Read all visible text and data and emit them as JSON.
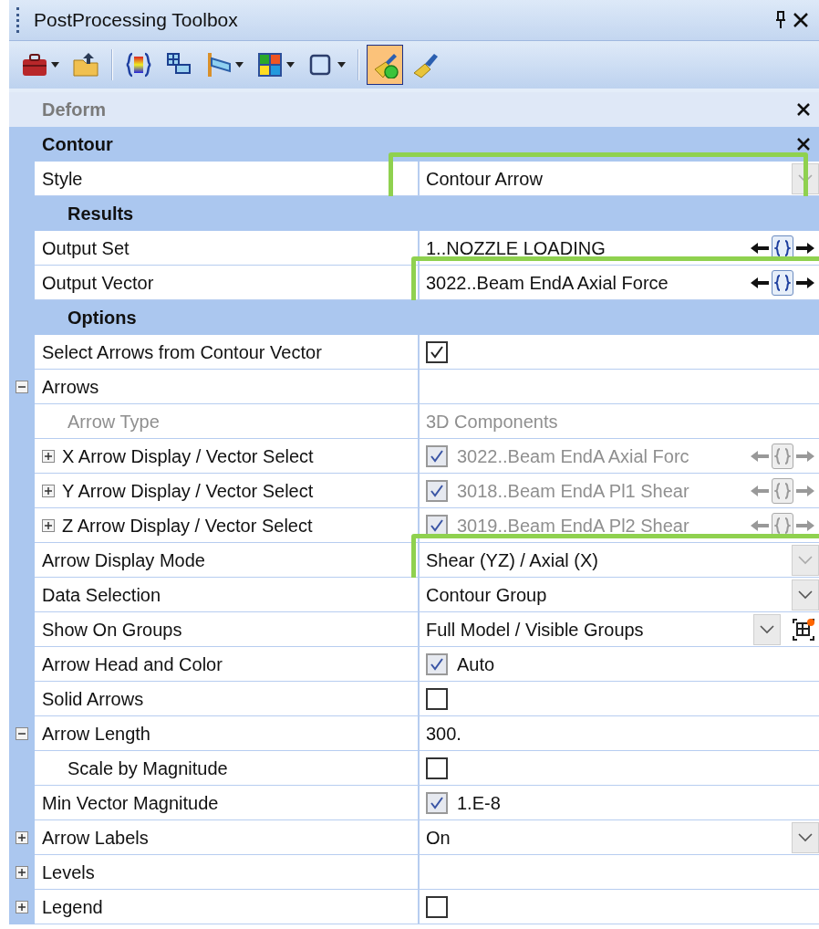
{
  "window": {
    "title": "PostProcessing Toolbox"
  },
  "toolbar": [
    {
      "kind": "toolbox",
      "dropdown": true,
      "selected": false
    },
    {
      "kind": "folder-up",
      "selected": false
    },
    {
      "kind": "separator"
    },
    {
      "kind": "braces",
      "selected": false
    },
    {
      "kind": "blocks",
      "selected": false
    },
    {
      "kind": "flag",
      "dropdown": true,
      "selected": false
    },
    {
      "kind": "color-grid",
      "dropdown": true,
      "selected": false
    },
    {
      "kind": "square",
      "dropdown": true,
      "selected": false
    },
    {
      "kind": "separator"
    },
    {
      "kind": "brush-ball",
      "selected": true
    },
    {
      "kind": "brush",
      "selected": false
    }
  ],
  "sections": [
    {
      "title": "Deform",
      "active": false
    },
    {
      "title": "Contour",
      "active": true,
      "rows": [
        {
          "kind": "dropdown",
          "label": "Style",
          "value": "Contour Arrow",
          "highlighted": true
        },
        {
          "kind": "group",
          "label": "Results",
          "children": [
            {
              "kind": "vector",
              "label": "Output Set",
              "value": "1..NOZZLE LOADING"
            },
            {
              "kind": "vector",
              "label": "Output Vector",
              "value": "3022..Beam EndA Axial Force",
              "highlighted": true
            }
          ]
        },
        {
          "kind": "group",
          "label": "Options",
          "children": [
            {
              "kind": "checkbox",
              "label": "Select Arrows from Contour Vector",
              "checked": true
            },
            {
              "kind": "empty",
              "label": "Arrows",
              "expanded": true,
              "children": [
                {
                  "kind": "text",
                  "label": "Arrow Type",
                  "value": "3D Components",
                  "disabled": true
                },
                {
                  "kind": "checkbox-vector",
                  "label": "X Arrow Display / Vector Select",
                  "checked": true,
                  "value": "3022..Beam EndA Axial Forc",
                  "expanded": false,
                  "disabled": true
                },
                {
                  "kind": "checkbox-vector",
                  "label": "Y Arrow Display / Vector Select",
                  "checked": true,
                  "value": "3018..Beam EndA Pl1 Shear",
                  "expanded": false,
                  "disabled": true
                },
                {
                  "kind": "checkbox-vector",
                  "label": "Z Arrow Display / Vector Select",
                  "checked": true,
                  "value": "3019..Beam EndA Pl2 Shear",
                  "expanded": false,
                  "disabled": true
                }
              ]
            },
            {
              "kind": "dropdown",
              "label": "Arrow Display Mode",
              "value": "Shear (YZ) / Axial (X)",
              "highlighted": true
            },
            {
              "kind": "dropdown",
              "label": "Data Selection",
              "value": "Contour Group"
            },
            {
              "kind": "dropdown-button",
              "label": "Show On Groups",
              "value": "Full Model / Visible Groups"
            },
            {
              "kind": "checkbox",
              "label": "Arrow Head and Color",
              "checked": true,
              "value": "Auto"
            },
            {
              "kind": "checkbox",
              "label": "Solid Arrows",
              "checked": false
            },
            {
              "kind": "text",
              "label": "Arrow Length",
              "value": "300.",
              "expanded": true,
              "children": [
                {
                  "kind": "checkbox",
                  "label": "Scale by Magnitude",
                  "checked": false
                }
              ]
            },
            {
              "kind": "checkbox",
              "label": "Min Vector Magnitude",
              "checked": true,
              "value": "1.E-8"
            },
            {
              "kind": "dropdown",
              "label": "Arrow Labels",
              "value": "On",
              "expanded": false
            },
            {
              "kind": "empty",
              "label": "Levels",
              "expanded": false
            },
            {
              "kind": "checkbox",
              "label": "Legend",
              "checked": false,
              "expanded": false
            }
          ]
        }
      ]
    }
  ]
}
